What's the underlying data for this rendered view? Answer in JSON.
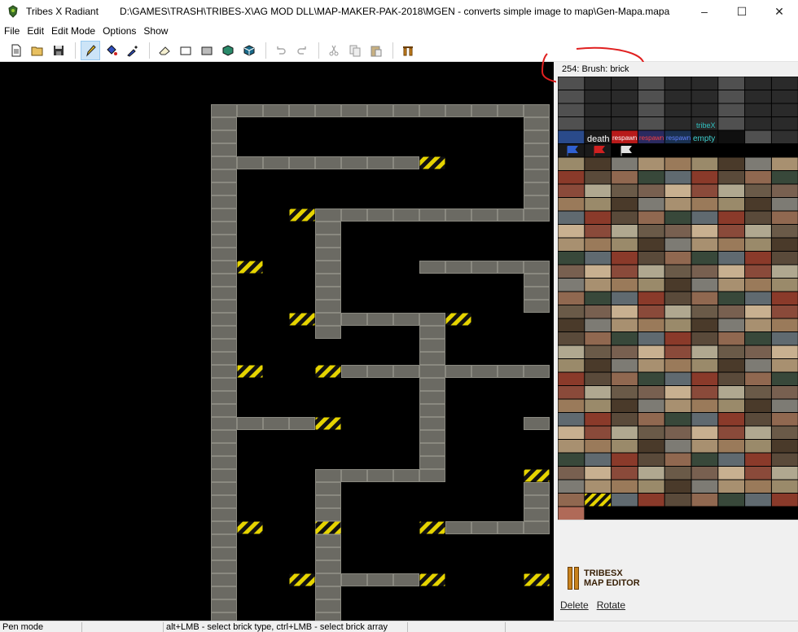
{
  "window": {
    "app_name": "Tribes X Radiant",
    "path": "D:\\GAMES\\TRASH\\TRIBES-X\\AG MOD DLL\\MAP-MAKER-PAK-2018\\MGEN - converts simple image to map\\Gen-Mapa.mapa",
    "minimize": "–",
    "maximize": "☐",
    "close": "✕"
  },
  "menu": [
    "File",
    "Edit",
    "Edit Mode",
    "Options",
    "Show"
  ],
  "toolbar": {
    "icons": [
      "new-file-icon",
      "open-folder-icon",
      "save-icon",
      "pencil-icon",
      "paint-bucket-icon",
      "pipette-icon",
      "eraser-icon",
      "rectangle-icon",
      "filled-rectangle-icon",
      "fill-cube-icon",
      "cube-icon",
      "undo-icon",
      "redo-icon",
      "cut-icon",
      "copy-icon",
      "paste-icon",
      "columns-icon"
    ]
  },
  "brush_info": "254: Brush: brick",
  "palette_labels": {
    "death": "death",
    "respawn": "respawn",
    "empty": "empty",
    "tribesx": "tribeX"
  },
  "logo": {
    "line1": "TRIBESX",
    "line2": "MAP EDITOR"
  },
  "panel_buttons": {
    "delete": "Delete",
    "rotate": "Rotate"
  },
  "status": {
    "mode": "Pen mode",
    "hint": "alt+LMB - select brick type, ctrl+LMB - select brick array"
  },
  "colors": {
    "brick": "#6b6a63",
    "hazard_yellow": "#e6d400",
    "annotation": "#e02020",
    "canvas_bg": "#000000"
  }
}
